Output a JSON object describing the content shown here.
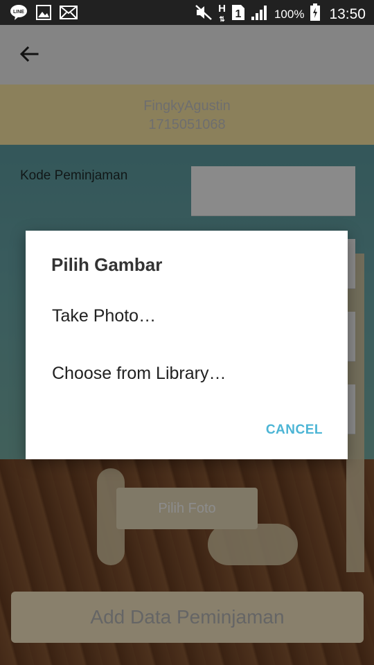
{
  "status_bar": {
    "battery_percent": "100%",
    "time": "13:50",
    "network_h": "H",
    "sim": "1",
    "icons": [
      "line-icon",
      "gallery-icon",
      "mail-icon",
      "mute-icon",
      "signal-icon",
      "battery-icon"
    ]
  },
  "header": {
    "name": "FingkyAgustin",
    "id": "1715051068"
  },
  "form": {
    "kode_label": "Kode Peminjaman"
  },
  "buttons": {
    "pilih_foto": "Pilih Foto",
    "add": "Add Data Peminjaman"
  },
  "dialog": {
    "title": "Pilih Gambar",
    "items": [
      {
        "label": "Take Photo…"
      },
      {
        "label": "Choose from Library…"
      }
    ],
    "cancel": "CANCEL"
  },
  "colors": {
    "accent": "#4cb5d5",
    "header_bg": "#fde9a7",
    "statusbar_bg": "#212121"
  }
}
